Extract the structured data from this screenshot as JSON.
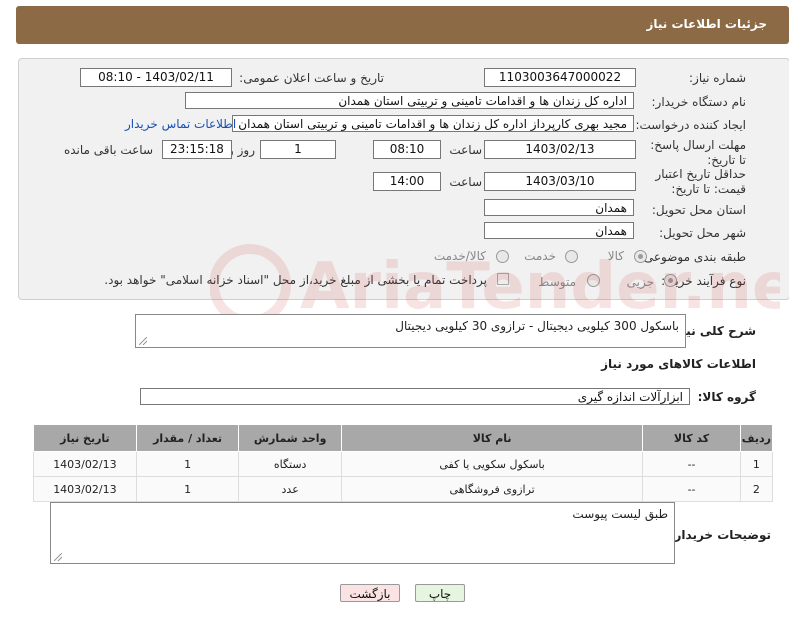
{
  "header": {
    "title": "جزئیات اطلاعات نیاز"
  },
  "form": {
    "need_number_label": "شماره نیاز:",
    "need_number": "1103003647000022",
    "announce_label": "تاریخ و ساعت اعلان عمومی:",
    "announce_value": "1403/02/11 - 08:10",
    "buyer_label": "نام دستگاه خریدار:",
    "buyer_value": "اداره کل زندان ها و اقدامات تامینی و تربیتی استان همدان",
    "creator_label": "ایجاد کننده درخواست:",
    "creator_value": "مجید بهری کارپرداز اداره کل زندان ها و اقدامات تامینی و تربیتی استان همدان",
    "contact_link": "اطلاعات تماس خریدار",
    "deadline_label": "مهلت ارسال پاسخ: تا تاریخ:",
    "deadline_date": "1403/02/13",
    "time_label": "ساعت",
    "deadline_time": "08:10",
    "days_value": "1",
    "days_label": "روز و",
    "remaining_time": "23:15:18",
    "remaining_label": "ساعت باقی مانده",
    "validity_label": "حداقل تاریخ اعتبار قیمت: تا تاریخ:",
    "validity_date": "1403/03/10",
    "validity_time": "14:00",
    "province_label": "استان محل تحویل:",
    "province_value": "همدان",
    "city_label": "شهر محل تحویل:",
    "city_value": "همدان",
    "category_label": "طبقه بندی موضوعی:",
    "category_options": [
      "کالا",
      "خدمت",
      "کالا/خدمت"
    ],
    "category_selected": "کالا",
    "process_label": "نوع فرآیند خرید :",
    "process_options": [
      "جزیی",
      "متوسط"
    ],
    "process_selected": "جزیی",
    "payment_note": "پرداخت تمام یا بخشی از مبلغ خرید،از محل \"اسناد خزانه اسلامی\" خواهد بود."
  },
  "summary": {
    "label": "شرح کلی نیاز:",
    "value": "باسکول 300 کیلویی دیجیتال - ترازوی 30 کیلویی دیجیتال"
  },
  "goods": {
    "section_title": "اطلاعات کالاهای مورد نیاز",
    "group_label": "گروه کالا:",
    "group_value": "ابزارآلات اندازه گیری",
    "columns": [
      "ردیف",
      "کد کالا",
      "نام کالا",
      "واحد شمارش",
      "تعداد / مقدار",
      "تاریخ نیاز"
    ],
    "rows": [
      [
        "1",
        "--",
        "باسکول سکویی یا کفی",
        "دستگاه",
        "1",
        "1403/02/13"
      ],
      [
        "2",
        "--",
        "ترازوی فروشگاهی",
        "عدد",
        "1",
        "1403/02/13"
      ]
    ]
  },
  "buyer_notes": {
    "label": "توضیحات خریدار:",
    "value": "طبق لیست پیوست"
  },
  "buttons": {
    "print": "چاپ",
    "back": "بازگشت"
  },
  "watermark": {
    "text": "AriaTender.neT"
  }
}
